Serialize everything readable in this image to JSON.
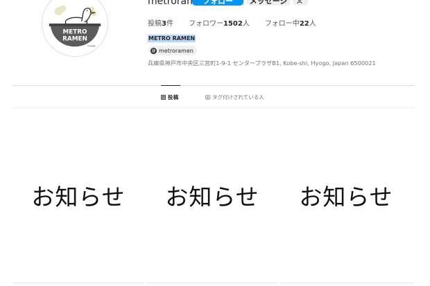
{
  "profile": {
    "username": "metroramen",
    "follow_label": "フォロー",
    "message_label": "メッセージ",
    "more_icon": "person-add-icon",
    "display_name": "METRO RAMEN",
    "threads_handle": "metroramen",
    "address": "兵庫県神戸市中央区三宮町1-9-1 センタープラザB1, Kobe-shi, Hyogo, Japan 6500021"
  },
  "avatar": {
    "logo_text_1": "METRO",
    "logo_text_2": "RAMEN",
    "logo_small": "©ORGB"
  },
  "stats": {
    "posts_label": "投稿",
    "posts_count": "3",
    "posts_unit": "件",
    "followers_label": "フォロワー",
    "followers_count": "1502",
    "followers_unit": "人",
    "following_label": "フォロー中",
    "following_count": "22",
    "following_unit": "人"
  },
  "tabs": [
    {
      "label": "投稿"
    },
    {
      "label": "タグ付けされている人"
    }
  ],
  "posts": [
    {
      "text": "お知らせ"
    },
    {
      "text": "お知らせ"
    },
    {
      "text": "お知らせ"
    }
  ]
}
